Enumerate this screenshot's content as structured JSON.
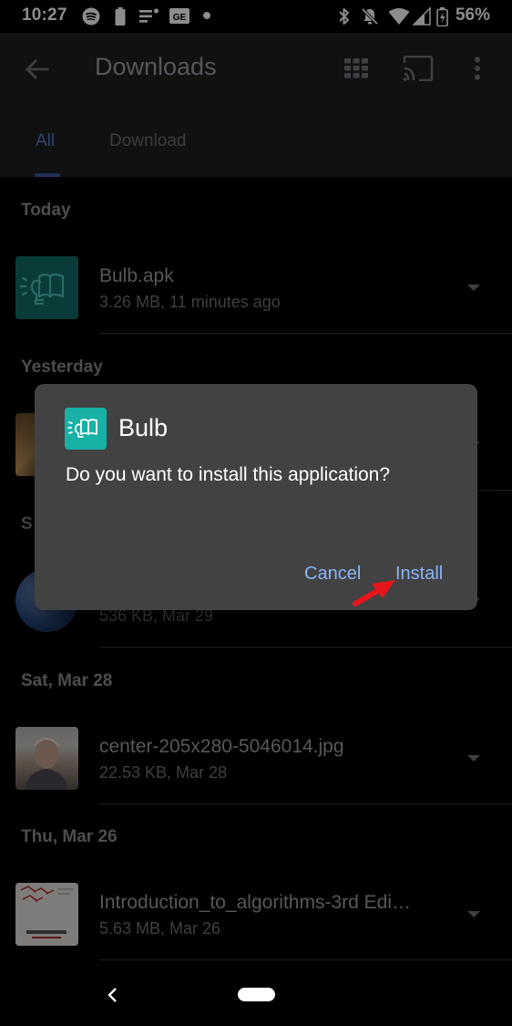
{
  "status_bar": {
    "time": "10:27",
    "battery_percent": "56%",
    "left_icons": [
      "spotify-icon",
      "battery-saver-icon",
      "notes-icon",
      "ge-icon",
      "dot-icon"
    ],
    "right_icons": [
      "bluetooth-icon",
      "mute-icon",
      "wifi-icon",
      "signal-icon",
      "battery-icon"
    ]
  },
  "app_bar": {
    "title": "Downloads",
    "icons": [
      "back-arrow-icon",
      "grid-view-icon",
      "cast-icon",
      "more-vert-icon"
    ],
    "tabs": [
      {
        "label": "All",
        "selected": true
      },
      {
        "label": "Download",
        "selected": false
      }
    ]
  },
  "sections": [
    {
      "label": "Today"
    },
    {
      "label": "Yesterday"
    },
    {
      "label": "S"
    },
    {
      "label": "Sat, Mar 28"
    },
    {
      "label": "Thu, Mar 26"
    }
  ],
  "files": [
    {
      "name": "Bulb.apk",
      "meta": "3.26 MB, 11 minutes ago"
    },
    {
      "name": "",
      "meta": "536 KB, Mar 29"
    },
    {
      "name": "center-205x280-5046014.jpg",
      "meta": "22.53 KB, Mar 28"
    },
    {
      "name": "Introduction_to_algorithms-3rd Edi…",
      "meta": "5.63 MB, Mar 26"
    }
  ],
  "dialog": {
    "app_name": "Bulb",
    "message": "Do you want to install this application?",
    "cancel_label": "Cancel",
    "install_label": "Install",
    "accent_color": "#8ab4f8",
    "icon_color": "#17b1a6"
  },
  "annotation": {
    "arrow_color": "#e8141b"
  }
}
